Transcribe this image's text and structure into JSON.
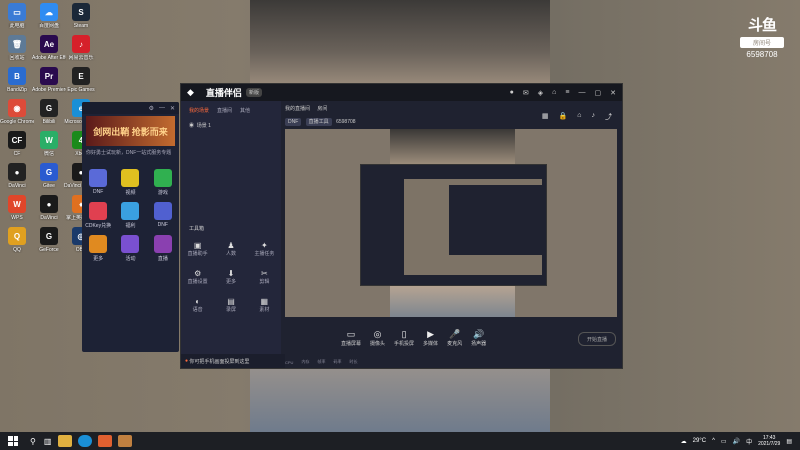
{
  "desktop_icons": [
    {
      "label": "此电脑",
      "color": "#3a7bd5",
      "glyph": "▭"
    },
    {
      "label": "百度网盘",
      "color": "#2f8cf2",
      "glyph": "☁"
    },
    {
      "label": "Steam",
      "color": "#1b2838",
      "glyph": "S"
    },
    {
      "label": "回收站",
      "color": "#5e7a96",
      "glyph": "🗑"
    },
    {
      "label": "Adobe After Effects 2020",
      "color": "#2a0a4e",
      "glyph": "Ae"
    },
    {
      "label": "网易云音乐",
      "color": "#d6202a",
      "glyph": "♪"
    },
    {
      "label": "BandiZip",
      "color": "#2a6cd0",
      "glyph": "B"
    },
    {
      "label": "Adobe Premiere",
      "color": "#2a0a4e",
      "glyph": "Pr"
    },
    {
      "label": "Epic Games",
      "color": "#222222",
      "glyph": "E"
    },
    {
      "label": "Google Chrome",
      "color": "#dd4b39",
      "glyph": "◉"
    },
    {
      "label": "Bilibili",
      "color": "#222222",
      "glyph": "G"
    },
    {
      "label": "Microsoft Edge",
      "color": "#1a8fd6",
      "glyph": "e"
    },
    {
      "label": "CF",
      "color": "#1a1a1a",
      "glyph": "CF"
    },
    {
      "label": "微信",
      "color": "#2aae67",
      "glyph": "W"
    },
    {
      "label": "Xbox",
      "color": "#1b8a1b",
      "glyph": "4"
    },
    {
      "label": "DaVinci",
      "color": "#222222",
      "glyph": "●"
    },
    {
      "label": "Gitee",
      "color": "#2a5bd0",
      "glyph": "G"
    },
    {
      "label": "DaVinci Resolve",
      "color": "#1a1a1a",
      "glyph": "●"
    },
    {
      "label": "WPS",
      "color": "#e0462a",
      "glyph": "W"
    },
    {
      "label": "DaVinci",
      "color": "#1a1a1a",
      "glyph": "●"
    },
    {
      "label": "掌上英雄联盟",
      "color": "#e07020",
      "glyph": "♦"
    },
    {
      "label": "QQ",
      "color": "#e0a020",
      "glyph": "Q"
    },
    {
      "label": "GeForce",
      "color": "#1a1a1a",
      "glyph": "G"
    },
    {
      "label": "OBS",
      "color": "#1a3a6a",
      "glyph": "◎"
    }
  ],
  "brand": {
    "logo": "斗鱼",
    "room_label": "房间号",
    "room_number": "6598708"
  },
  "side_panel": {
    "banner_text": "剑网出鞘 抢影而来",
    "info_text": "你好勇士试玩新，DNF一站式服务专题",
    "apps": [
      {
        "label": "DNF",
        "color": "#5a6ad8"
      },
      {
        "label": "视频",
        "color": "#e0c020"
      },
      {
        "label": "游戏",
        "color": "#30b050"
      },
      {
        "label": "CDKey兑换",
        "color": "#e04050"
      },
      {
        "label": "福利",
        "color": "#3aa0e0"
      },
      {
        "label": "DNF",
        "color": "#5060d0"
      },
      {
        "label": "更多",
        "color": "#e08a20"
      },
      {
        "label": "活动",
        "color": "#7a50d0"
      },
      {
        "label": "直播",
        "color": "#8a40b0"
      }
    ]
  },
  "main_window": {
    "title": "直播伴侣",
    "version": "新版",
    "tabs": [
      "我的场景",
      "直播间",
      "其他"
    ],
    "scene_label": "场景 1",
    "tools_title": "工具箱",
    "tools": [
      {
        "label": "直播助手",
        "glyph": "▣"
      },
      {
        "label": "人数",
        "glyph": "♟"
      },
      {
        "label": "主播任务",
        "glyph": "✦"
      },
      {
        "label": "直播设置",
        "glyph": "⚙"
      },
      {
        "label": "更多",
        "glyph": "⬇"
      },
      {
        "label": "剪辑",
        "glyph": "✂"
      },
      {
        "label": "语音",
        "glyph": "◐"
      },
      {
        "label": "录屏",
        "glyph": "▤"
      },
      {
        "label": "素材",
        "glyph": "▦"
      }
    ],
    "notice": "你可把手机画面投屏到这里",
    "header_items": [
      "我的直播间",
      "房间"
    ],
    "category_tags": [
      "DNF",
      "直播工具"
    ],
    "room_number": "6598708",
    "bottom_buttons": [
      {
        "label": "直播屏幕",
        "glyph": "▭"
      },
      {
        "label": "摄像头",
        "glyph": "◎"
      },
      {
        "label": "手机投屏",
        "glyph": "▯"
      },
      {
        "label": "多媒体",
        "glyph": "▶"
      },
      {
        "label": "麦克风",
        "glyph": "🎤"
      },
      {
        "label": "扬声器",
        "glyph": "🔊"
      }
    ],
    "start_button": "开始直播",
    "status_items": [
      "CPU",
      "内存",
      "帧率",
      "码率",
      "时长"
    ]
  },
  "taskbar": {
    "temperature": "29°C",
    "time": "17:43",
    "date": "2021/7/29",
    "lang": "中"
  }
}
